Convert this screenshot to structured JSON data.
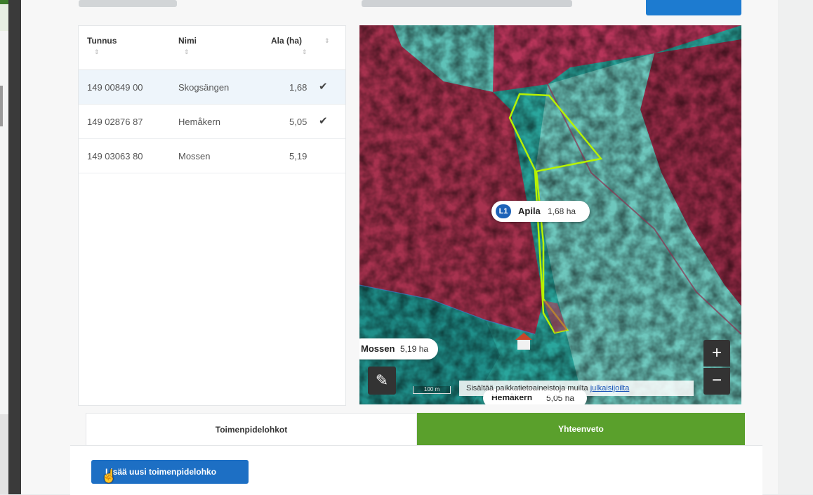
{
  "table": {
    "headers": {
      "tunnus": "Tunnus",
      "nimi": "Nimi",
      "ala": "Ala (ha)"
    },
    "rows": [
      {
        "tunnus": "149 00849 00",
        "nimi": "Skogsängen",
        "ala": "1,68",
        "checked": true
      },
      {
        "tunnus": "149 02876 87",
        "nimi": "Hemåkern",
        "ala": "5,05",
        "checked": true
      },
      {
        "tunnus": "149 03063 80",
        "nimi": "Mossen",
        "ala": "5,19",
        "checked": false
      }
    ],
    "sort_glyph": "⇕",
    "check_glyph": "✔"
  },
  "map": {
    "main_label": {
      "badge": "L1",
      "name": "Apila",
      "area": "1,68 ha"
    },
    "mossen_label": {
      "name": "Mossen",
      "area": "5,19 ha"
    },
    "hemakern_label": {
      "name": "Hemåkern",
      "area": "5,05 ha"
    },
    "scale": "100 m",
    "attribution": "Sisältää paikkatietoaineistoja muilta",
    "attribution_link": "julkaisijoilta",
    "zoom_in": "+",
    "zoom_out": "−",
    "edit_icon": "✎"
  },
  "tabs": {
    "left": "Toimenpidelohkot",
    "right": "Yhteenveto"
  },
  "add_button": "Lisää uusi toimenpidelohko",
  "colors": {
    "accent_blue": "#1d6fc4",
    "tab_green": "#5aa02c",
    "parcel_outline": "#b7f200"
  }
}
